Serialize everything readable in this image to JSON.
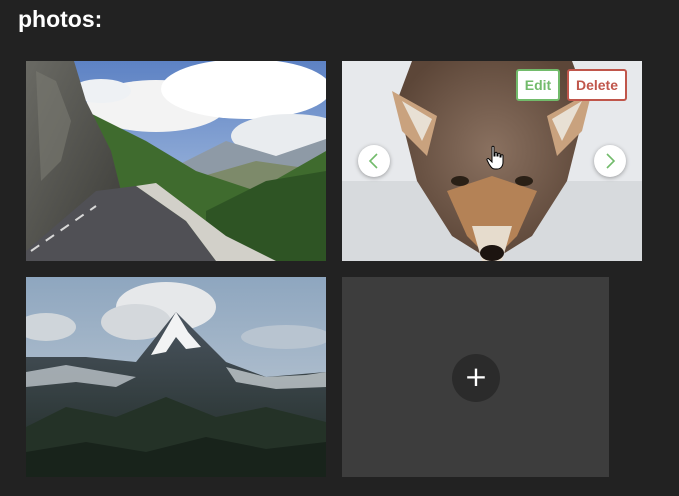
{
  "page": {
    "heading": "photos:"
  },
  "photos": [
    {
      "subject": "mountain road"
    },
    {
      "subject": "coyote",
      "hovered": true
    },
    {
      "subject": "snowy mountain peak"
    }
  ],
  "actions": {
    "edit_label": "Edit",
    "delete_label": "Delete",
    "add_label": "+"
  },
  "icons": {
    "prev": "chevron-left-icon",
    "next": "chevron-right-icon",
    "add": "plus-icon",
    "cursor": "hand-pointer-cursor"
  },
  "colors": {
    "background": "#222222",
    "add_tile": "#3d3d3d",
    "edit": "#72bb6b",
    "delete": "#c0564b"
  }
}
